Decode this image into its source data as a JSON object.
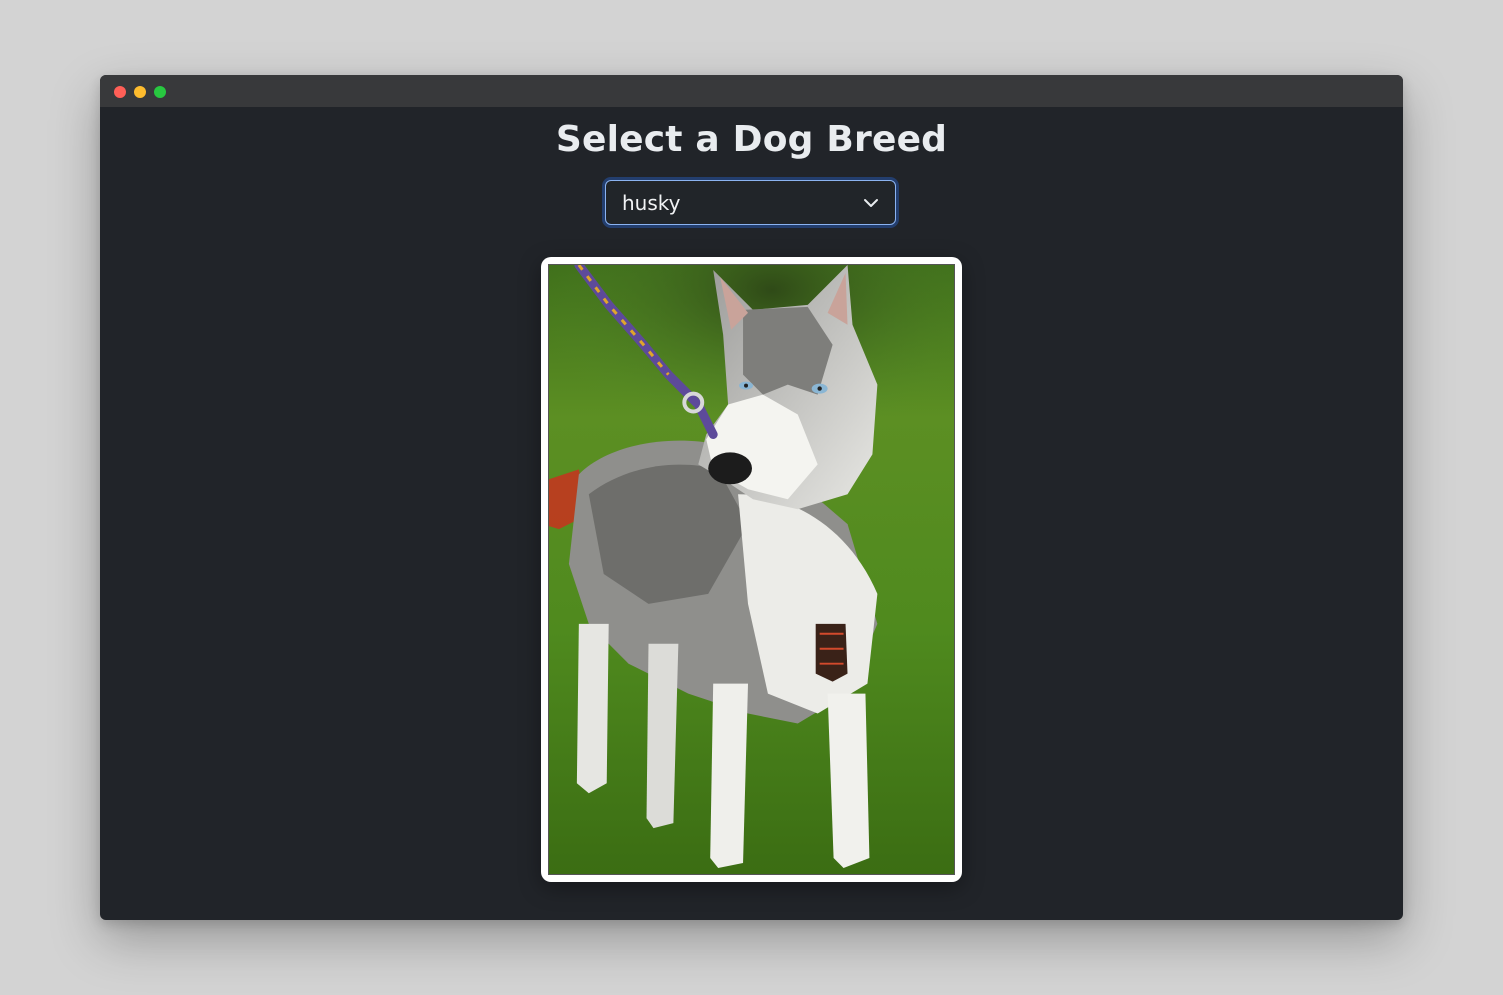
{
  "window": {
    "controls": [
      "close",
      "minimize",
      "zoom"
    ]
  },
  "page": {
    "title": "Select a Dog Breed"
  },
  "breed_select": {
    "selected": "husky",
    "icon": "chevron-down-icon"
  },
  "dog_image": {
    "breed": "husky",
    "subject": "Siberian husky puppy on a leash standing on green grass"
  },
  "colors": {
    "background": "#212429",
    "titlebar": "#38393b",
    "focus_ring": "#8bb3f0",
    "text": "#e9ecef"
  }
}
